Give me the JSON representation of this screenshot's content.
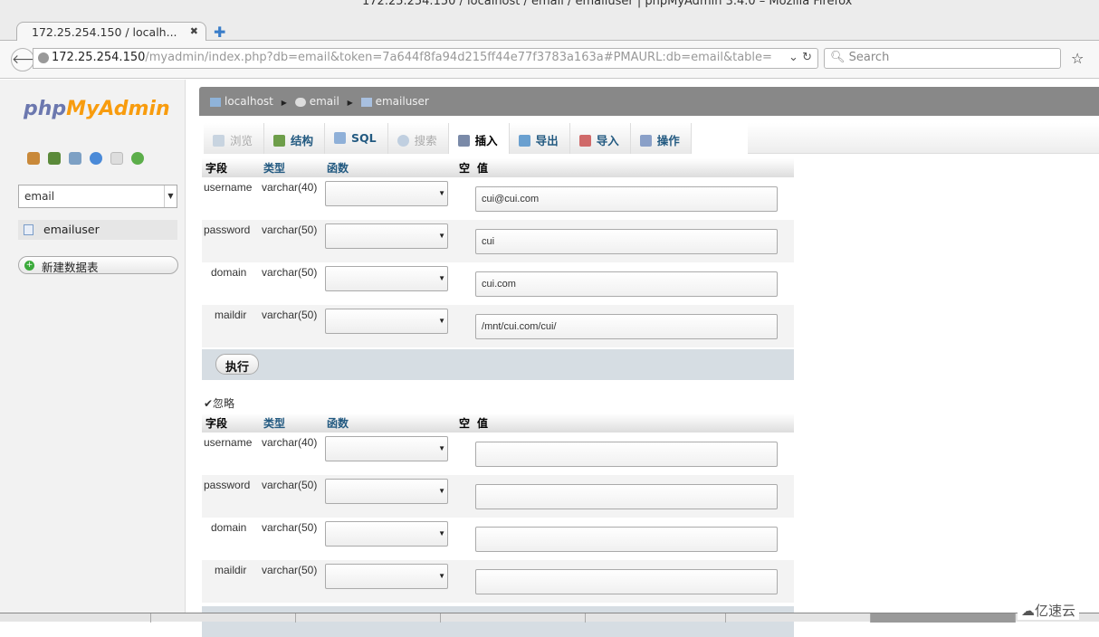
{
  "window": {
    "title": "172.25.254.150 / localhost / email / emailuser | phpMyAdmin 3.4.0 – Mozilla Firefox"
  },
  "browser": {
    "tab_title": "172.25.254.150 / localh...",
    "url_host": "172.25.254.150",
    "url_path": "/myadmin/index.php?db=email&token=7a644f8fa94d215ff44e77f3783a163a#PMAURL:db=email&table=",
    "search_placeholder": "Search"
  },
  "sidebar": {
    "logo_php": "php",
    "logo_myadmin": "MyAdmin",
    "db_selected": "email",
    "tables": [
      "emailuser"
    ],
    "new_table_label": "新建数据表"
  },
  "breadcrumb": {
    "server": "localhost",
    "database": "email",
    "table": "emailuser"
  },
  "tabs": [
    {
      "label": "浏览",
      "state": "disabled"
    },
    {
      "label": "结构",
      "state": "normal"
    },
    {
      "label": "SQL",
      "state": "normal"
    },
    {
      "label": "搜索",
      "state": "disabled"
    },
    {
      "label": "插入",
      "state": "active"
    },
    {
      "label": "导出",
      "state": "normal"
    },
    {
      "label": "导入",
      "state": "normal"
    },
    {
      "label": "操作",
      "state": "normal"
    }
  ],
  "columns": {
    "field": "字段",
    "type": "类型",
    "function": "函数",
    "null": "空",
    "value": "值"
  },
  "form1": {
    "rows": [
      {
        "field": "username",
        "type": "varchar(40)",
        "value": "cui@cui.com"
      },
      {
        "field": "password",
        "type": "varchar(50)",
        "value": "cui"
      },
      {
        "field": "domain",
        "type": "varchar(50)",
        "value": "cui.com"
      },
      {
        "field": "maildir",
        "type": "varchar(50)",
        "value": "/mnt/cui.com/cui/"
      }
    ],
    "execute_label": "执行"
  },
  "ignore_label": "✔忽略",
  "ignore_checked": true,
  "form2": {
    "rows": [
      {
        "field": "username",
        "type": "varchar(40)",
        "value": ""
      },
      {
        "field": "password",
        "type": "varchar(50)",
        "value": ""
      },
      {
        "field": "domain",
        "type": "varchar(50)",
        "value": ""
      },
      {
        "field": "maildir",
        "type": "varchar(50)",
        "value": ""
      }
    ]
  },
  "watermark": "亿速云"
}
